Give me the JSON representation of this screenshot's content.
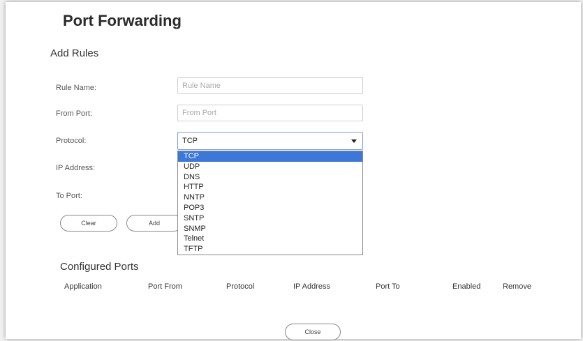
{
  "title": "Port Forwarding",
  "add_rules": {
    "heading": "Add Rules",
    "rule_name": {
      "label": "Rule Name:",
      "placeholder": "Rule Name"
    },
    "from_port": {
      "label": "From Port:",
      "placeholder": "From Port"
    },
    "protocol": {
      "label": "Protocol:",
      "selected": "TCP"
    },
    "ip_address": {
      "label": "IP Address:"
    },
    "to_port": {
      "label": "To Port:"
    },
    "buttons": {
      "clear": "Clear",
      "add": "Add"
    }
  },
  "protocol_options": [
    "TCP",
    "UDP",
    "DNS",
    "HTTP",
    "NNTP",
    "POP3",
    "SNTP",
    "SNMP",
    "Telnet",
    "TFTP"
  ],
  "configured_ports": {
    "heading": "Configured Ports",
    "columns": [
      "Application",
      "Port From",
      "Protocol",
      "IP Address",
      "Port To",
      "Enabled",
      "Remove"
    ]
  },
  "close_label": "Close",
  "colors": {
    "highlight": "#3d78d8",
    "select_border": "#7a9cd8"
  },
  "icons": {
    "dropdown": "chevron-down-icon"
  }
}
